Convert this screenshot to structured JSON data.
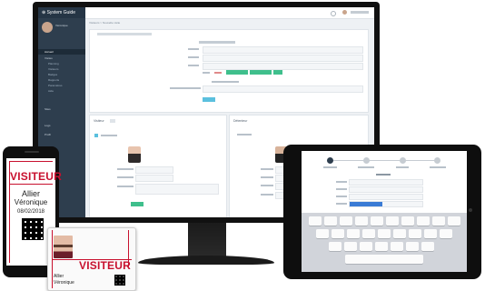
{
  "desktop": {
    "brand": "System Guide",
    "user_label": "Véronique",
    "nav": [
      "Accueil",
      "Visites",
      "Planning",
      "Visiteurs",
      "Badges",
      "Rapports",
      "Paramètres",
      "Aide",
      "Sites",
      "Logs",
      "Profil"
    ],
    "breadcrumb": "Visiteurs > Nouvelle visite",
    "panel_left_title": "Visiteur",
    "panel_right_title": "Détenteur"
  },
  "phone": {
    "badge_title": "VISITEUR",
    "first_name": "Allier",
    "last_name": "Véronique",
    "date": "08/02/2018"
  },
  "badge": {
    "title": "VISITEUR",
    "first_name": "Allier",
    "last_name": "Véronique"
  },
  "tablet": {
    "steps": [
      "1",
      "2",
      "3",
      "4"
    ],
    "keyboard_rows": [
      [
        "Q",
        "W",
        "E",
        "R",
        "T",
        "Y",
        "U",
        "I",
        "O",
        "P"
      ],
      [
        "A",
        "S",
        "D",
        "F",
        "G",
        "H",
        "J",
        "K",
        "L"
      ],
      [
        "Z",
        "X",
        "C",
        "V",
        "B",
        "N",
        "M"
      ]
    ]
  },
  "colors": {
    "accent_red": "#c8102e",
    "sidebar": "#2e3e4e",
    "button_green": "#3fbf8c",
    "button_blue": "#5bc0de"
  }
}
